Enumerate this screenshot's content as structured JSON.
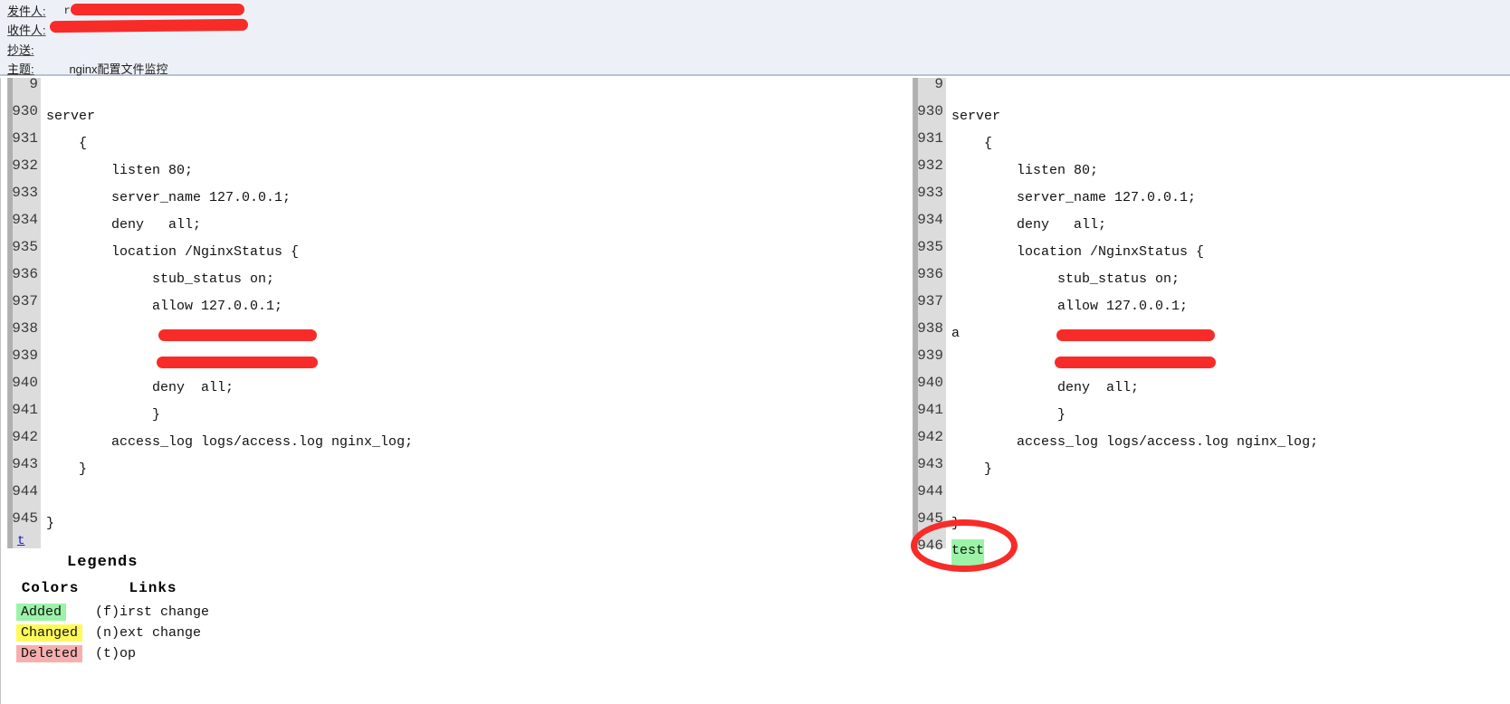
{
  "mail": {
    "fields": [
      {
        "label": "发件人:",
        "value": "root",
        "redacted": true
      },
      {
        "label": "收件人:",
        "value": "",
        "redacted": true
      },
      {
        "label": "抄送:",
        "value": "",
        "redacted": false
      },
      {
        "label": "主题:",
        "value": "nginx配置文件监控",
        "redacted": false
      }
    ]
  },
  "diff": {
    "left": {
      "top_line_fragment": "9",
      "rows": [
        {
          "no": "9",
          "code": "",
          "state": "none"
        },
        {
          "no": "930",
          "code": "server",
          "state": "none"
        },
        {
          "no": "931",
          "code": "    {",
          "state": "none"
        },
        {
          "no": "932",
          "code": "        listen 80;",
          "state": "none"
        },
        {
          "no": "933",
          "code": "        server_name 127.0.0.1;",
          "state": "none"
        },
        {
          "no": "934",
          "code": "        deny   all;",
          "state": "none"
        },
        {
          "no": "935",
          "code": "        location /NginxStatus {",
          "state": "none"
        },
        {
          "no": "936",
          "code": "             stub_status on;",
          "state": "none"
        },
        {
          "no": "937",
          "code": "             allow 127.0.0.1;",
          "state": "none"
        },
        {
          "no": "938",
          "code": "",
          "state": "redacted"
        },
        {
          "no": "939",
          "code": "",
          "state": "redacted"
        },
        {
          "no": "940",
          "code": "             deny  all;",
          "state": "none"
        },
        {
          "no": "941",
          "code": "             }",
          "state": "none"
        },
        {
          "no": "942",
          "code": "        access_log logs/access.log nginx_log;",
          "state": "none"
        },
        {
          "no": "943",
          "code": "    }",
          "state": "none"
        },
        {
          "no": "944",
          "code": "",
          "state": "none"
        },
        {
          "no": "945",
          "code": "}",
          "state": "none"
        }
      ],
      "top_link": "t"
    },
    "right": {
      "rows": [
        {
          "no": "9",
          "code": "",
          "state": "none"
        },
        {
          "no": "930",
          "code": "server",
          "state": "none"
        },
        {
          "no": "931",
          "code": "    {",
          "state": "none"
        },
        {
          "no": "932",
          "code": "        listen 80;",
          "state": "none"
        },
        {
          "no": "933",
          "code": "        server_name 127.0.0.1;",
          "state": "none"
        },
        {
          "no": "934",
          "code": "        deny   all;",
          "state": "none"
        },
        {
          "no": "935",
          "code": "        location /NginxStatus {",
          "state": "none"
        },
        {
          "no": "936",
          "code": "             stub_status on;",
          "state": "none"
        },
        {
          "no": "937",
          "code": "             allow 127.0.0.1;",
          "state": "none"
        },
        {
          "no": "938",
          "code": "a",
          "state": "redacted"
        },
        {
          "no": "939",
          "code": "",
          "state": "redacted"
        },
        {
          "no": "940",
          "code": "             deny  all;",
          "state": "none"
        },
        {
          "no": "941",
          "code": "             }",
          "state": "none"
        },
        {
          "no": "942",
          "code": "        access_log logs/access.log nginx_log;",
          "state": "none"
        },
        {
          "no": "943",
          "code": "    }",
          "state": "none"
        },
        {
          "no": "944",
          "code": "",
          "state": "none"
        },
        {
          "no": "945",
          "code": "}",
          "state": "none"
        },
        {
          "no": "946",
          "code": "test",
          "state": "added"
        }
      ]
    }
  },
  "legends": {
    "title": "Legends",
    "col_colors": "Colors",
    "col_links": "Links",
    "rows": [
      {
        "color_label": "Added",
        "color_class": "sw-added",
        "link": "(f)irst change"
      },
      {
        "color_label": "Changed",
        "color_class": "sw-changed",
        "link": "(n)ext change"
      },
      {
        "color_label": "Deleted",
        "color_class": "sw-deleted",
        "link": "(t)op"
      }
    ]
  },
  "colors": {
    "added": "#9cf3a8",
    "changed": "#fffa5a",
    "deleted": "#f9aeae",
    "annotation": "#f72c28",
    "header_bg": "#edf1f7",
    "gutter_bg": "#dcdcdc"
  }
}
